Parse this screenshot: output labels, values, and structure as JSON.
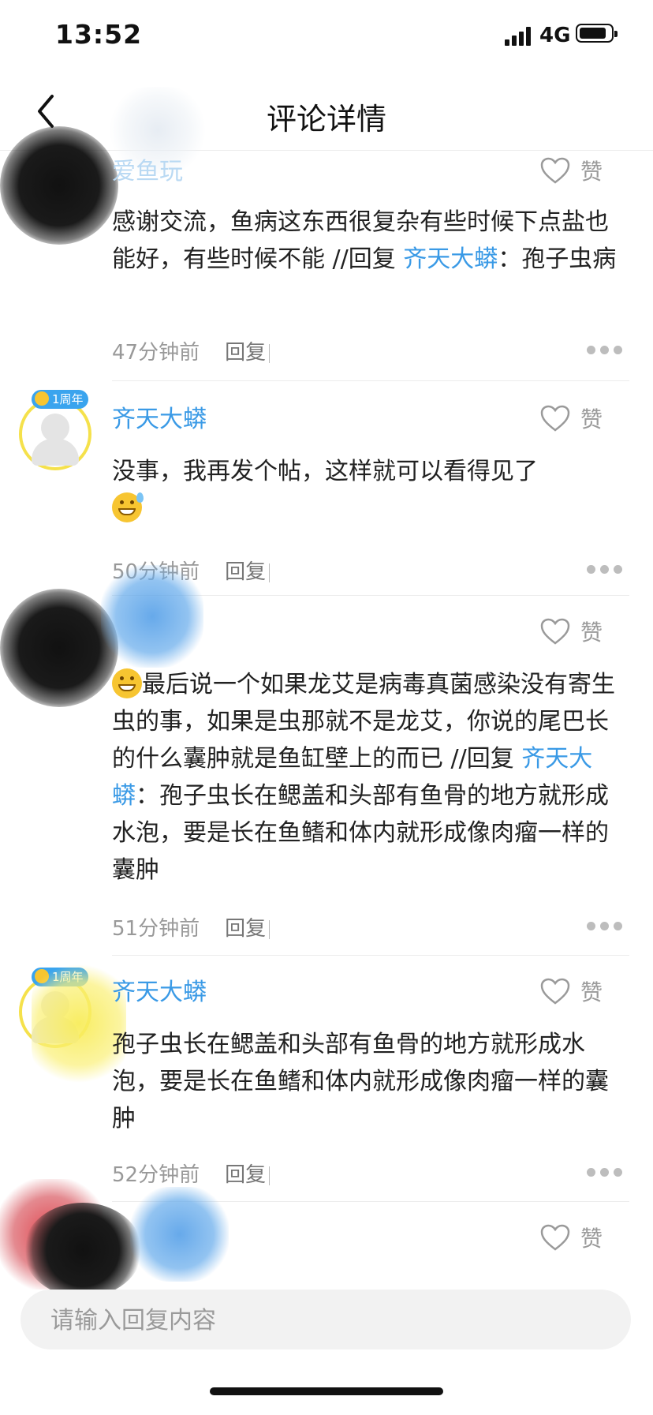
{
  "status_bar": {
    "time": "13:52",
    "network": "4G"
  },
  "nav": {
    "title": "评论详情"
  },
  "comments": [
    {
      "username": "爱鱼玩",
      "like_label": "赞",
      "content_parts": [
        "感谢交流，鱼病这东西很复杂有些时候下点盐也能好，有些时候不能 //回复 ",
        "齐天大蟒",
        "：孢子虫病"
      ],
      "time": "47分钟前",
      "reply_label": "回复"
    },
    {
      "username": "齐天大蟒",
      "badge": "1周年",
      "like_label": "赞",
      "content": "没事，我再发个帖，这样就可以看得见了",
      "time": "50分钟前",
      "reply_label": "回复"
    },
    {
      "username": "",
      "like_label": "赞",
      "content_parts": [
        "最后说一个如果龙艾是病毒真菌感染没有寄生虫的事，如果是虫那就不是龙艾，你说的尾巴长的什么囊肿就是鱼缸壁上的而已 //回复 ",
        "齐天大蟒",
        "：孢子虫长在鳃盖和头部有鱼骨的地方就形成水泡，要是长在鱼鳍和体内就形成像肉瘤一样的囊肿"
      ],
      "time": "51分钟前",
      "reply_label": "回复"
    },
    {
      "username": "齐天大蟒",
      "badge": "1周年",
      "like_label": "赞",
      "content": "孢子虫长在鳃盖和头部有鱼骨的地方就形成水泡，要是长在鱼鳍和体内就形成像肉瘤一样的囊肿",
      "time": "52分钟前",
      "reply_label": "回复"
    },
    {
      "username": "",
      "like_label": "赞"
    }
  ],
  "reply_input": {
    "placeholder": "请输入回复内容"
  },
  "colors": {
    "link": "#3a9ae6",
    "meta": "#999999",
    "badge": "#3aa4ee",
    "avatar_ring": "#f5e14b"
  }
}
